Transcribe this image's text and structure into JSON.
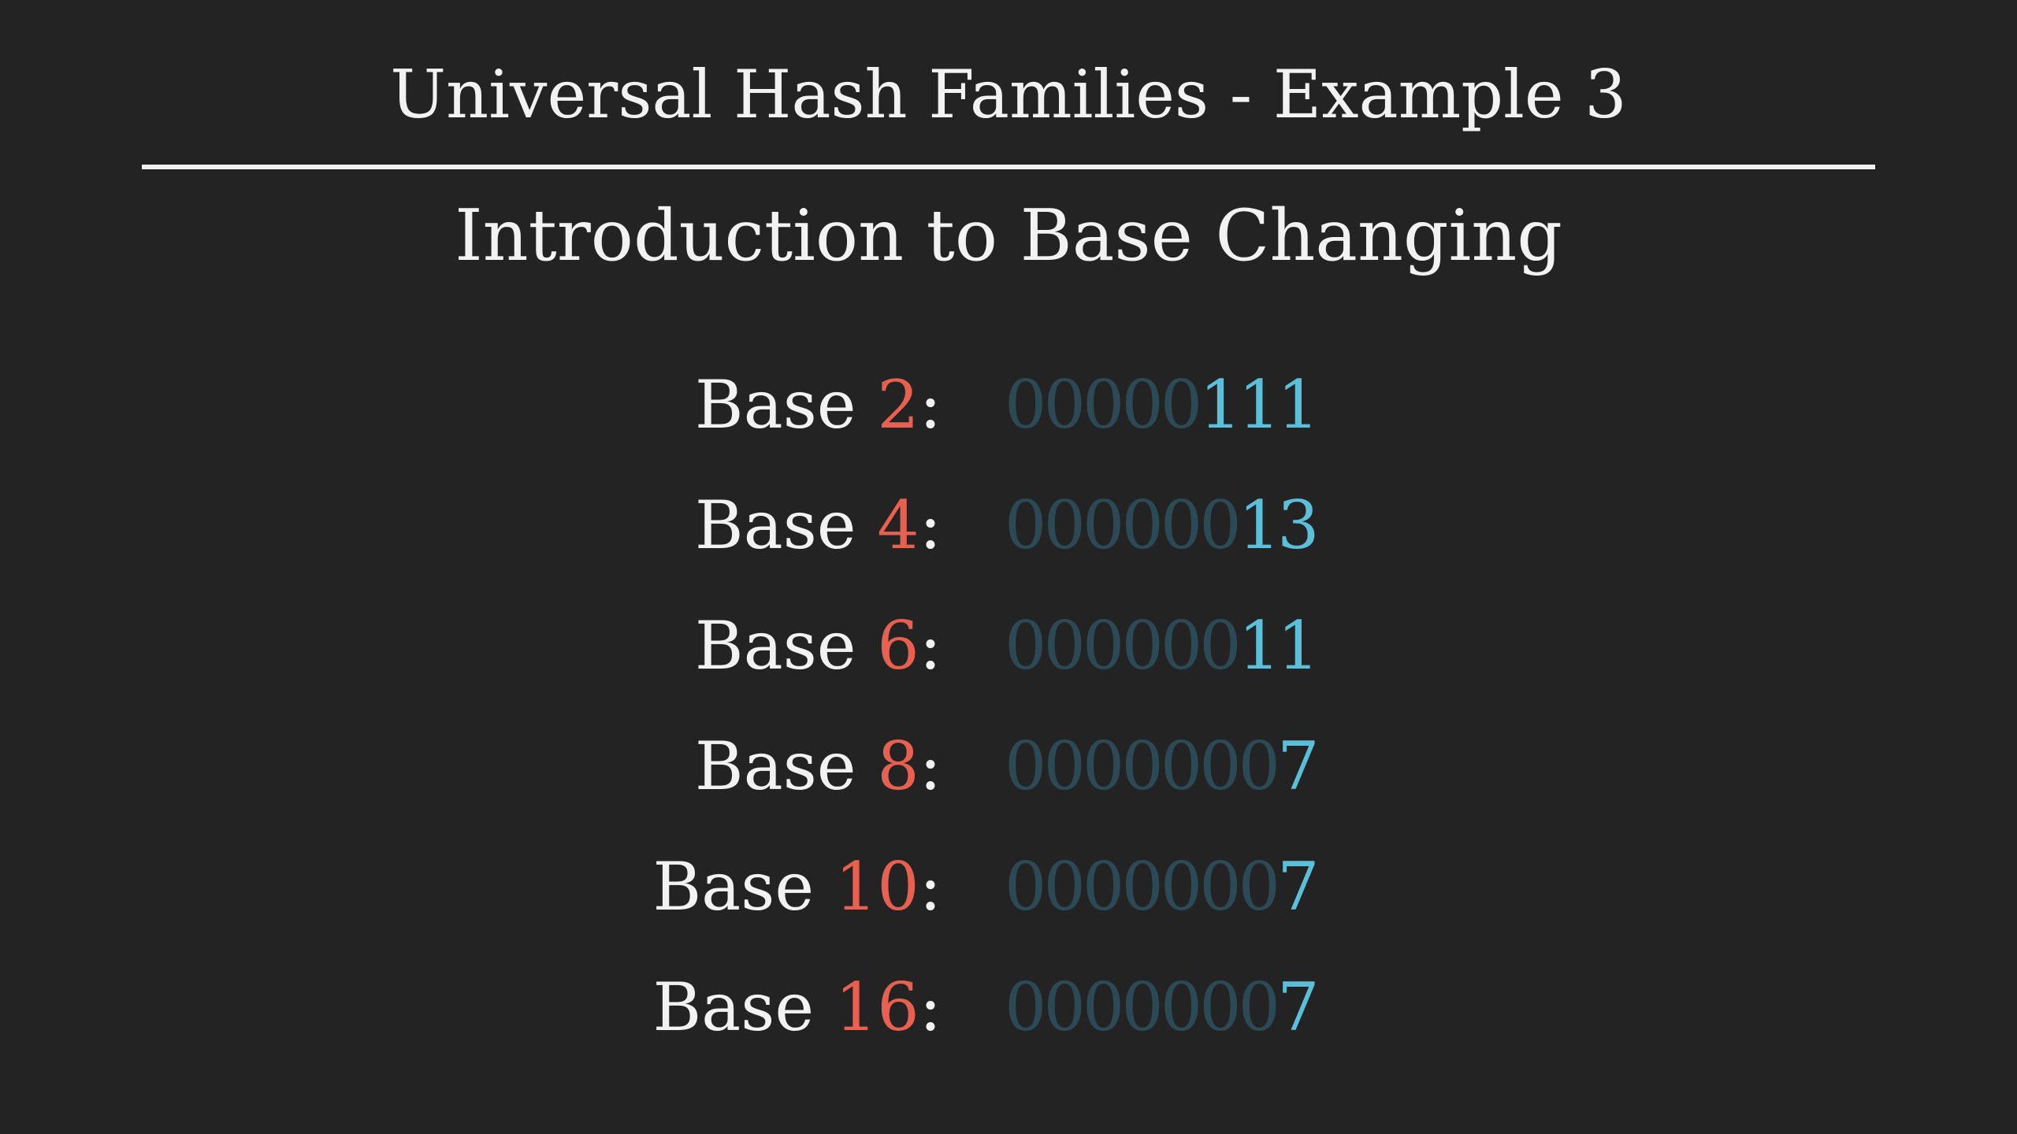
{
  "slide": {
    "title": "Universal Hash Families - Example 3",
    "subtitle": "Introduction to Base Changing"
  },
  "rows": [
    {
      "word": "Base",
      "base": "2",
      "colon": ":",
      "leading": "00000",
      "significant": "111"
    },
    {
      "word": "Base",
      "base": "4",
      "colon": ":",
      "leading": "000000",
      "significant": "13"
    },
    {
      "word": "Base",
      "base": "6",
      "colon": ":",
      "leading": "000000",
      "significant": "11"
    },
    {
      "word": "Base",
      "base": "8",
      "colon": ":",
      "leading": "0000000",
      "significant": "7"
    },
    {
      "word": "Base",
      "base": "10",
      "colon": ":",
      "leading": "0000000",
      "significant": "7"
    },
    {
      "word": "Base",
      "base": "16",
      "colon": ":",
      "leading": "0000000",
      "significant": "7"
    }
  ],
  "colors": {
    "background": "#232323",
    "text": "#f2f2f2",
    "base_number": "#e8604f",
    "leading_zeros": "#2c4a55",
    "significant_digits": "#5bbfd9"
  }
}
